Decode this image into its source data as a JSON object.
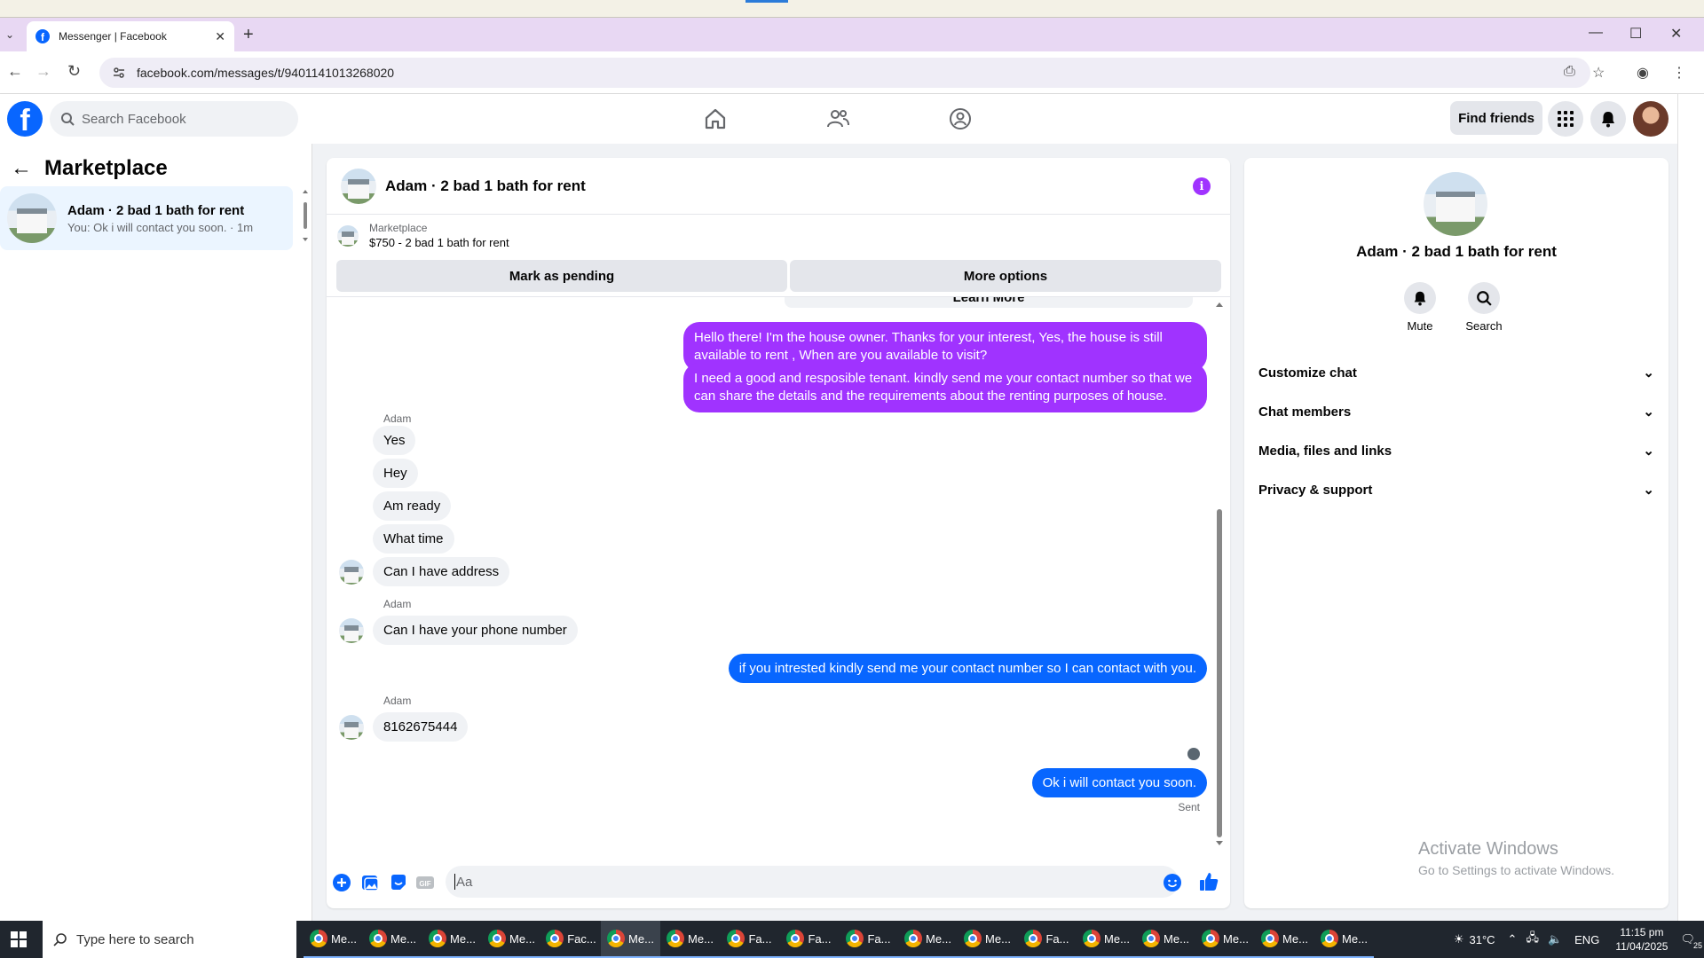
{
  "browser": {
    "tab_title": "Messenger | Facebook",
    "url": "facebook.com/messages/t/9401141013268020"
  },
  "fb": {
    "logo": "f",
    "search_placeholder": "Search Facebook",
    "find_friends": "Find friends"
  },
  "sidebar": {
    "title": "Marketplace",
    "conversation": {
      "name": "Adam · 2 bad 1 bath for rent",
      "snippet": "You: Ok i will contact you soon. · 1m"
    }
  },
  "chat": {
    "title": "Adam · 2 bad 1 bath for rent",
    "marketplace_label": "Marketplace",
    "listing": "$750 - 2 bad 1 bath for rent",
    "mark_pending": "Mark as pending",
    "more_options": "More options",
    "learn_more": "Learn More",
    "messages": {
      "m1": "Hello there! I'm the house owner. Thanks for your interest, Yes, the house is still available to rent , When are you available to visit?",
      "m2": "I need a good and resposible tenant.  kindly send me your contact number so that we can share the details and the requirements about the renting purposes of house.",
      "sender1": "Adam",
      "m3": "Yes",
      "m4": "Hey",
      "m5": "Am ready",
      "m6": "What time",
      "m7": "Can I have address",
      "sender2": "Adam",
      "m8": "Can I have your phone number",
      "m9": "if you intrested kindly send me your contact number so I can contact with you.",
      "sender3": "Adam",
      "m10": "8162675444",
      "m11": "Ok i will contact you soon.",
      "sent": "Sent"
    },
    "input_placeholder": "Aa",
    "gif_label": "GIF"
  },
  "info": {
    "name": "Adam · 2 bad 1 bath for rent",
    "mute": "Mute",
    "search": "Search",
    "sections": [
      "Customize chat",
      "Chat members",
      "Media, files and links",
      "Privacy & support"
    ],
    "activate_title": "Activate Windows",
    "activate_sub": "Go to Settings to activate Windows."
  },
  "taskbar": {
    "search_placeholder": "Type here to search",
    "apps": [
      "Me...",
      "Me...",
      "Me...",
      "Me...",
      "Fac...",
      "Me...",
      "Me...",
      "Fa...",
      "Fa...",
      "Fa...",
      "Me...",
      "Me...",
      "Fa...",
      "Me...",
      "Me...",
      "Me...",
      "Me...",
      "Me..."
    ],
    "temperature": "31°C",
    "language": "ENG",
    "time": "11:15 pm",
    "date": "11/04/2025",
    "notifications": "25"
  },
  "colors": {
    "facebook_blue": "#0866ff",
    "purple_bubble": "#a033ff",
    "incoming_bubble": "#f0f2f5"
  }
}
